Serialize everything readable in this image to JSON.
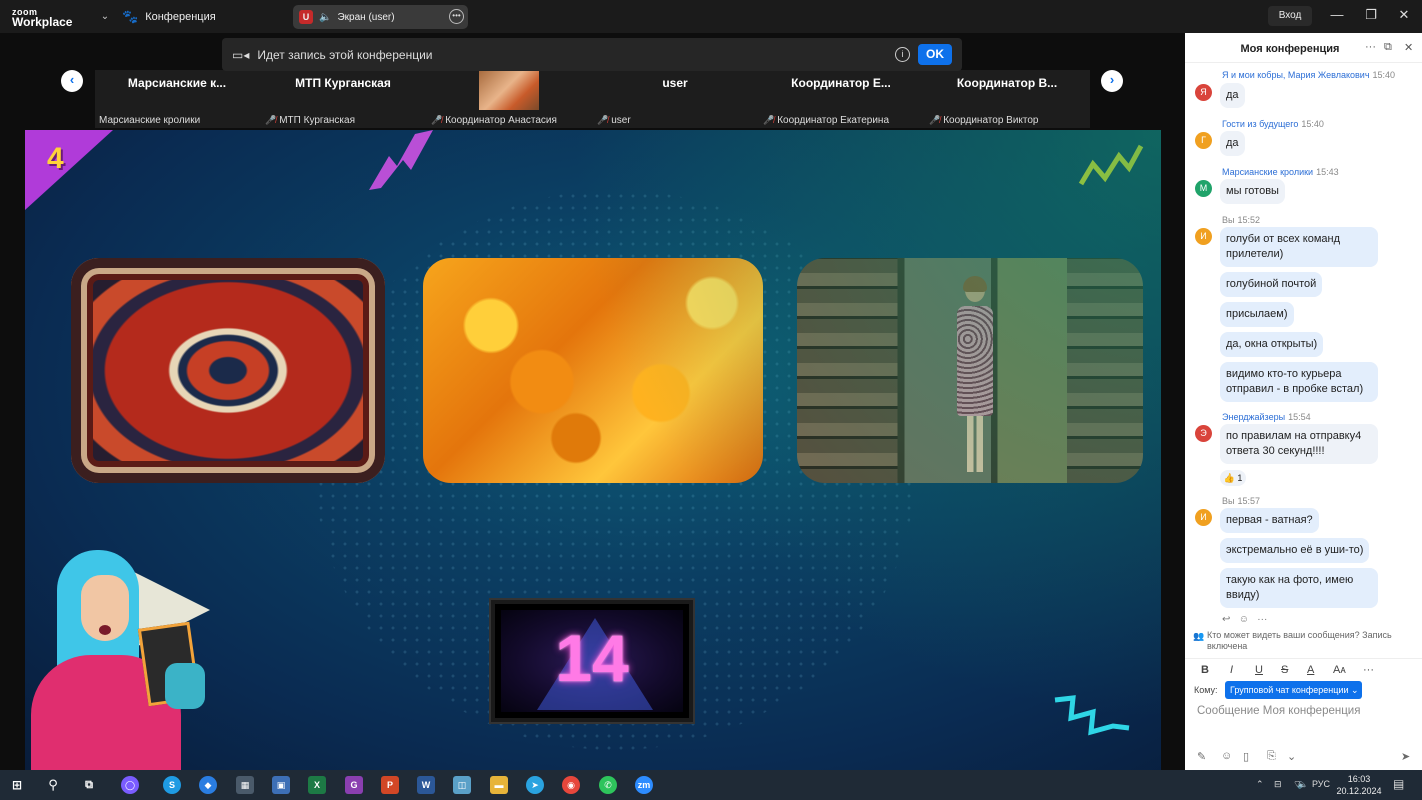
{
  "titlebar": {
    "logo_line1": "zoom",
    "logo_line2": "Workplace",
    "meeting_tab": "Конференция",
    "screen_tab": "Экран (user)",
    "screen_badge": "U",
    "login": "Вход"
  },
  "recording": {
    "text": "Идет запись этой конференции",
    "ok": "OK"
  },
  "gallery": {
    "tiles": [
      {
        "title": "Марсианские к...",
        "name": "Марсианские кролики",
        "muted": false
      },
      {
        "title": "МТП Курганская",
        "name": "МТП Курганская",
        "muted": true
      },
      {
        "title": "",
        "name": "Координатор Анастасия",
        "muted": true,
        "has_video": true
      },
      {
        "title": "user",
        "name": "user",
        "muted": true
      },
      {
        "title": "Координатор Е...",
        "name": "Координатор Екатерина",
        "muted": true
      },
      {
        "title": "Координатор В...",
        "name": "Координатор Виктор",
        "muted": true
      }
    ]
  },
  "slide": {
    "corner_number": "4",
    "timer_value": "14"
  },
  "chat": {
    "title": "Моя конференция",
    "messages": [
      {
        "sender": "Я и мои кобры, Мария Жевлакович",
        "time": "15:40",
        "avatar": "Я",
        "color": "#d9443b",
        "text": "да"
      },
      {
        "sender": "Гости из будущего",
        "time": "15:40",
        "avatar": "Г",
        "color": "#f0a020",
        "text": "да"
      },
      {
        "sender": "Марсианские кролики",
        "time": "15:43",
        "avatar": "М",
        "color": "#20a36a",
        "text": "мы готовы"
      },
      {
        "sender": "Вы",
        "time": "15:52",
        "avatar": "И",
        "color": "#f0a020",
        "texts": [
          "голуби от всех команд прилетели)",
          "голубиной почтой",
          "присылаем)",
          "да, окна открыты)",
          "видимо кто-то курьера отправил - в пробке встал)"
        ]
      },
      {
        "sender": "Энерджайзеры",
        "time": "15:54",
        "avatar": "Э",
        "color": "#d9443b",
        "text": "по правилам на отправку4 ответа 30 секунд!!!!",
        "reaction": "👍 1"
      },
      {
        "sender": "Вы",
        "time": "15:57",
        "avatar": "И",
        "color": "#f0a020",
        "texts": [
          "первая - ватная?",
          "экстремально её в уши-то)",
          "такую как на фото, имею ввиду)"
        ]
      }
    ],
    "notice": "Кто может видеть ваши сообщения? Запись включена",
    "to_label": "Кому:",
    "to_value": "Групповой чат конференции",
    "placeholder": "Сообщение Моя конференция"
  },
  "taskbar": {
    "lang": "РУС",
    "time": "16:03",
    "date": "20.12.2024"
  }
}
